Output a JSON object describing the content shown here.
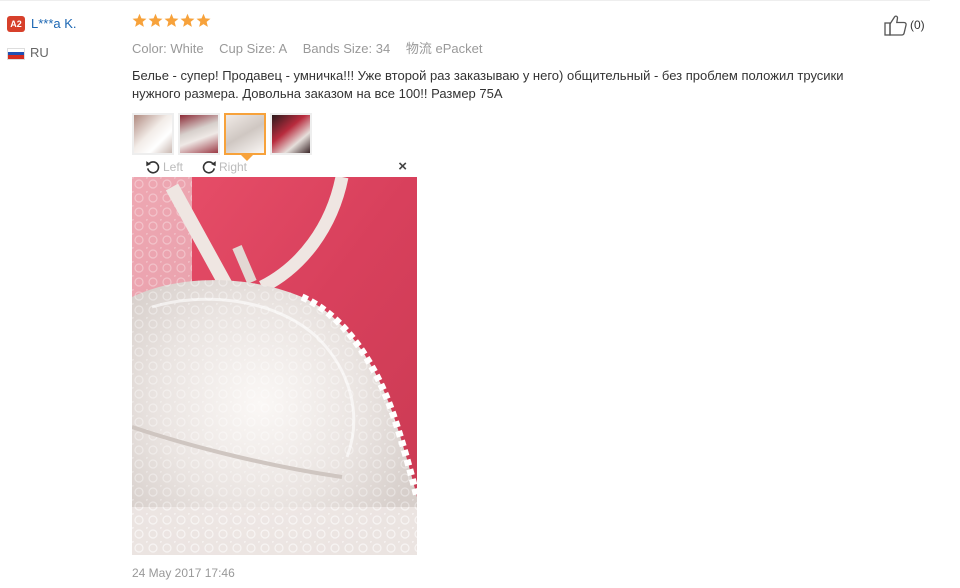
{
  "user": {
    "level": "A2",
    "name": "L***a K.",
    "country": "RU"
  },
  "review": {
    "rating": 5,
    "color_label": "Color:",
    "color_value": "White",
    "cup_label": "Cup Size:",
    "cup_value": "A",
    "bands_label": "Bands Size:",
    "bands_value": "34",
    "shipping_label": "物流",
    "shipping_value": "ePacket",
    "text": "Белье - супер! Продавец - умничка!!! Уже второй раз заказываю у него) общительный - без проблем положил трусики нужного размера. Довольна заказом на все 100!! Размер 75А",
    "date": "24 May 2017 17:46",
    "helpful_count": "(0)",
    "thumbnails": [
      "photo-1",
      "photo-2",
      "photo-3",
      "photo-4"
    ],
    "active_thumbnail": 3
  },
  "viewer": {
    "rotate_left": "Left",
    "rotate_right": "Right",
    "close": "×"
  },
  "colors": {
    "star": "#f7a23b",
    "user_link": "#1c67b3",
    "badge": "#d7402b",
    "active_border": "#f7a23b"
  },
  "icons": [
    "star-icon",
    "thumbs-up-icon",
    "rotate-left-icon",
    "rotate-right-icon",
    "close-icon",
    "russia-flag-icon"
  ]
}
